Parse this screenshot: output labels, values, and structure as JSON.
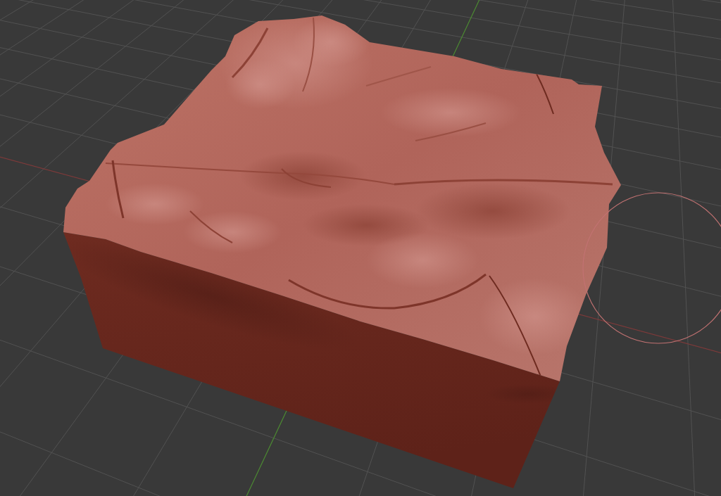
{
  "viewport": {
    "grid": true,
    "axes": true,
    "brush_cursor": true
  }
}
